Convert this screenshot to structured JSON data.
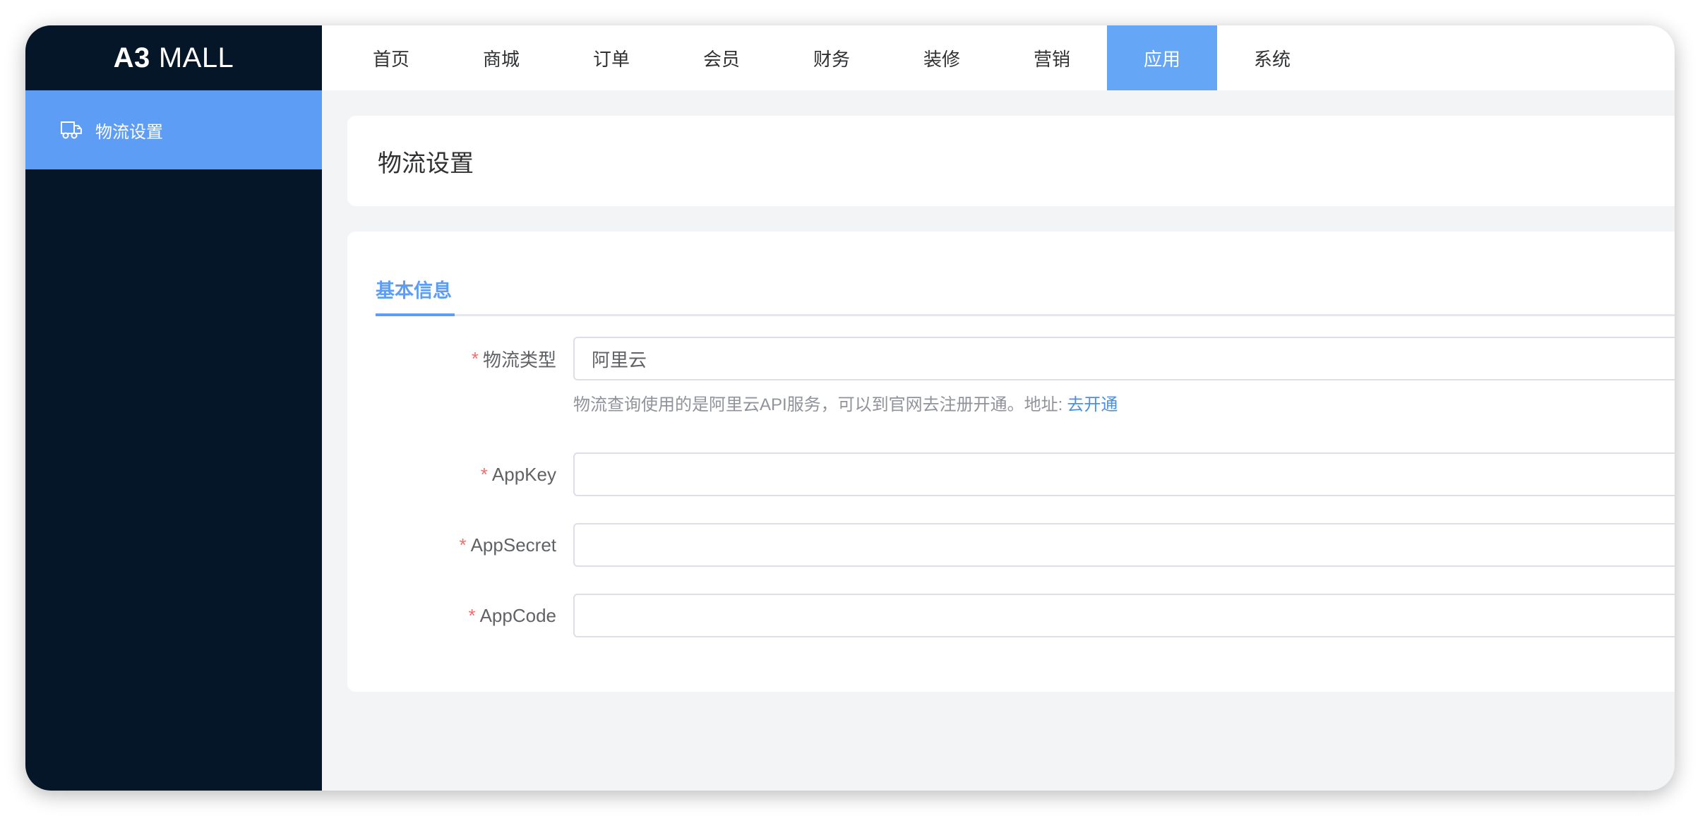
{
  "app": {
    "logo_bold": "A3",
    "logo_thin": "MALL"
  },
  "sidebar": {
    "items": [
      {
        "label": "物流设置",
        "icon": "truck-icon",
        "active": true
      }
    ]
  },
  "header": {
    "tabs": [
      {
        "label": "首页"
      },
      {
        "label": "商城"
      },
      {
        "label": "订单"
      },
      {
        "label": "会员"
      },
      {
        "label": "财务"
      },
      {
        "label": "装修"
      },
      {
        "label": "营销"
      },
      {
        "label": "应用",
        "active": true
      },
      {
        "label": "系统"
      }
    ]
  },
  "page": {
    "title": "物流设置"
  },
  "form": {
    "tab_label": "基本信息",
    "required_mark": "*",
    "fields": [
      {
        "label": "物流类型",
        "value": "阿里云",
        "placeholder": ""
      },
      {
        "label": "AppKey",
        "value": "",
        "placeholder": ""
      },
      {
        "label": "AppSecret",
        "value": "",
        "placeholder": ""
      },
      {
        "label": "AppCode",
        "value": "",
        "placeholder": ""
      }
    ],
    "help_text": "物流查询使用的是阿里云API服务，可以到官网去注册开通。地址:",
    "help_link": "去开通"
  },
  "colors": {
    "sidebar_bg": "#061629",
    "accent": "#5e9df6",
    "active_tab": "#66a6f7",
    "required": "#f56c6c",
    "link": "#4a90e2"
  }
}
